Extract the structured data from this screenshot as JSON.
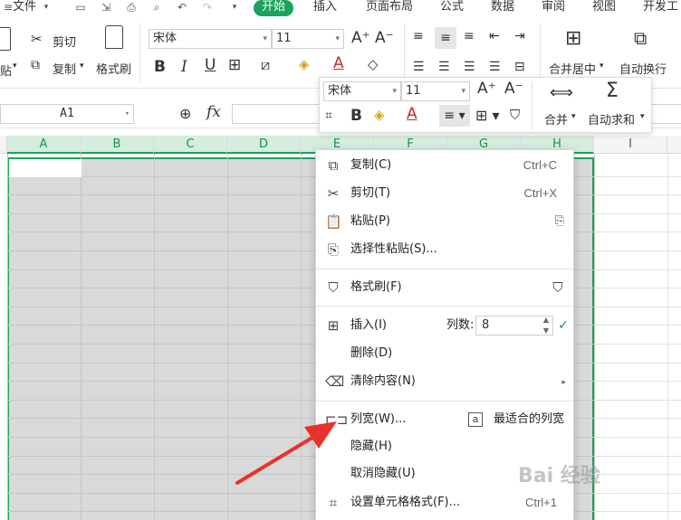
{
  "menubar": {
    "file": "文件",
    "tabs": [
      "开始",
      "插入",
      "页面布局",
      "公式",
      "数据",
      "审阅",
      "视图",
      "开发工"
    ]
  },
  "ribbon": {
    "cut": "剪切",
    "copy": "复制",
    "paste_partial": "贴",
    "format_painter": "格式刷",
    "font_name": "宋体",
    "font_size": "11",
    "merge_center": "合并居中",
    "wrap_text": "自动换行"
  },
  "formula_bar": {
    "cell_ref": "A1",
    "fx": "fx"
  },
  "columns": [
    "A",
    "B",
    "C",
    "D",
    "E",
    "F",
    "G",
    "H",
    "I"
  ],
  "mini_toolbar": {
    "font_name": "宋体",
    "font_size": "11",
    "merge": "合并",
    "autosum": "自动求和"
  },
  "context_menu": {
    "copy": {
      "label": "复制(C)",
      "shortcut": "Ctrl+C"
    },
    "cut": {
      "label": "剪切(T)",
      "shortcut": "Ctrl+X"
    },
    "paste": {
      "label": "粘贴(P)"
    },
    "paste_special": {
      "label": "选择性粘贴(S)..."
    },
    "format_painter": {
      "label": "格式刷(F)"
    },
    "insert": {
      "label": "插入(I)",
      "count_label": "列数:",
      "count_value": "8"
    },
    "delete": {
      "label": "删除(D)"
    },
    "clear": {
      "label": "清除内容(N)"
    },
    "col_width": {
      "label": "列宽(W)...",
      "best_fit": "最适合的列宽"
    },
    "hide": {
      "label": "隐藏(H)"
    },
    "unhide": {
      "label": "取消隐藏(U)"
    },
    "format_cells": {
      "label": "设置单元格格式(F)...",
      "shortcut": "Ctrl+1"
    }
  },
  "watermark": "Bai 经验",
  "colors": {
    "accent": "#1aa35b",
    "arrow": "#e8322b",
    "selection": "#d9d9d9"
  }
}
